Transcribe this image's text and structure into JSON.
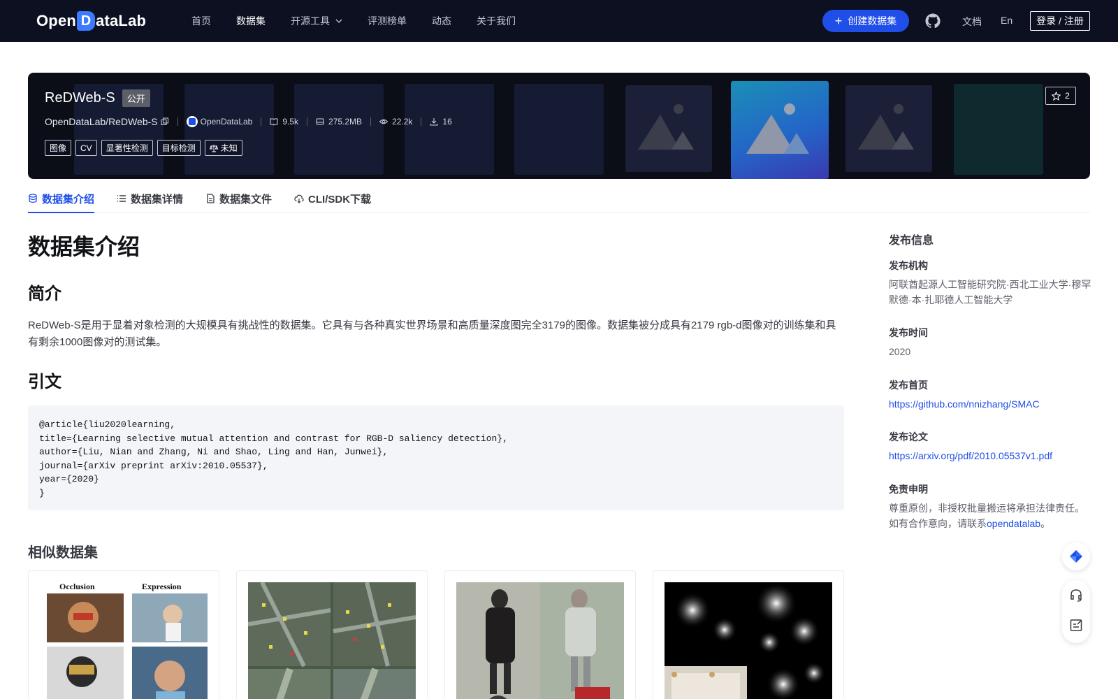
{
  "header": {
    "logo_left": "Open",
    "logo_d": "D",
    "logo_right": "ataLab",
    "nav": [
      {
        "label": "首页",
        "active": false
      },
      {
        "label": "数据集",
        "active": true
      },
      {
        "label": "开源工具",
        "active": false,
        "dropdown": true
      },
      {
        "label": "评测榜单",
        "active": false
      },
      {
        "label": "动态",
        "active": false
      },
      {
        "label": "关于我们",
        "active": false
      }
    ],
    "create_label": "创建数据集",
    "docs_label": "文档",
    "lang_label": "En",
    "login_label": "登录 / 注册",
    "github_icon": "github-icon"
  },
  "banner": {
    "title": "ReDWeb-S",
    "public_label": "公开",
    "path": "OpenDataLab/ReDWeb-S",
    "org": "OpenDataLab",
    "size_count": "9.5k",
    "file_size": "275.2MB",
    "views": "22.2k",
    "downloads": "16",
    "tags": [
      "图像",
      "CV",
      "显著性检测",
      "目标检测"
    ],
    "license_label": "未知",
    "stars": "2"
  },
  "tabs": [
    {
      "label": "数据集介绍",
      "active": true,
      "icon": "database-icon"
    },
    {
      "label": "数据集详情",
      "active": false,
      "icon": "list-icon"
    },
    {
      "label": "数据集文件",
      "active": false,
      "icon": "file-icon"
    },
    {
      "label": "CLI/SDK下载",
      "active": false,
      "icon": "cloud-download-icon"
    }
  ],
  "main": {
    "heading": "数据集介绍",
    "intro_heading": "简介",
    "intro_text": "ReDWeb-S是用于显着对象检测的大规模具有挑战性的数据集。它具有与各种真实世界场景和高质量深度图完全3179的图像。数据集被分成具有2179 rgb-d图像对的训练集和具有剩余1000图像对的测试集。",
    "citation_heading": "引文",
    "citation": "@article{liu2020learning,\ntitle={Learning selective mutual attention and contrast for RGB-D saliency detection},\nauthor={Liu, Nian and Zhang, Ni and Shao, Ling and Han, Junwei},\njournal={arXiv preprint arXiv:2010.05537},\nyear={2020}\n}",
    "similar_heading": "相似数据集",
    "card_texts": {
      "occlusion": "Occlusion",
      "expression": "Expression"
    }
  },
  "sidebar": {
    "title": "发布信息",
    "org_label": "发布机构",
    "org_value": "阿联酋起源人工智能研究院·西北工业大学·穆罕默德·本·扎耶德人工智能大学",
    "date_label": "发布时间",
    "date_value": "2020",
    "home_label": "发布首页",
    "home_value": "https://github.com/nnizhang/SMAC",
    "paper_label": "发布论文",
    "paper_value": "https://arxiv.org/pdf/2010.05537v1.pdf",
    "disclaimer_label": "免责申明",
    "disclaimer_line1": "尊重原创，非授权批量搬运将承担法律责任。",
    "disclaimer_line2_pre": "如有合作意向，请联系",
    "disclaimer_link": "opendatalab",
    "disclaimer_end": "。"
  },
  "colors": {
    "topbar": "#0c1021",
    "accent": "#1f4ee8",
    "banner": "#0b0d17"
  }
}
